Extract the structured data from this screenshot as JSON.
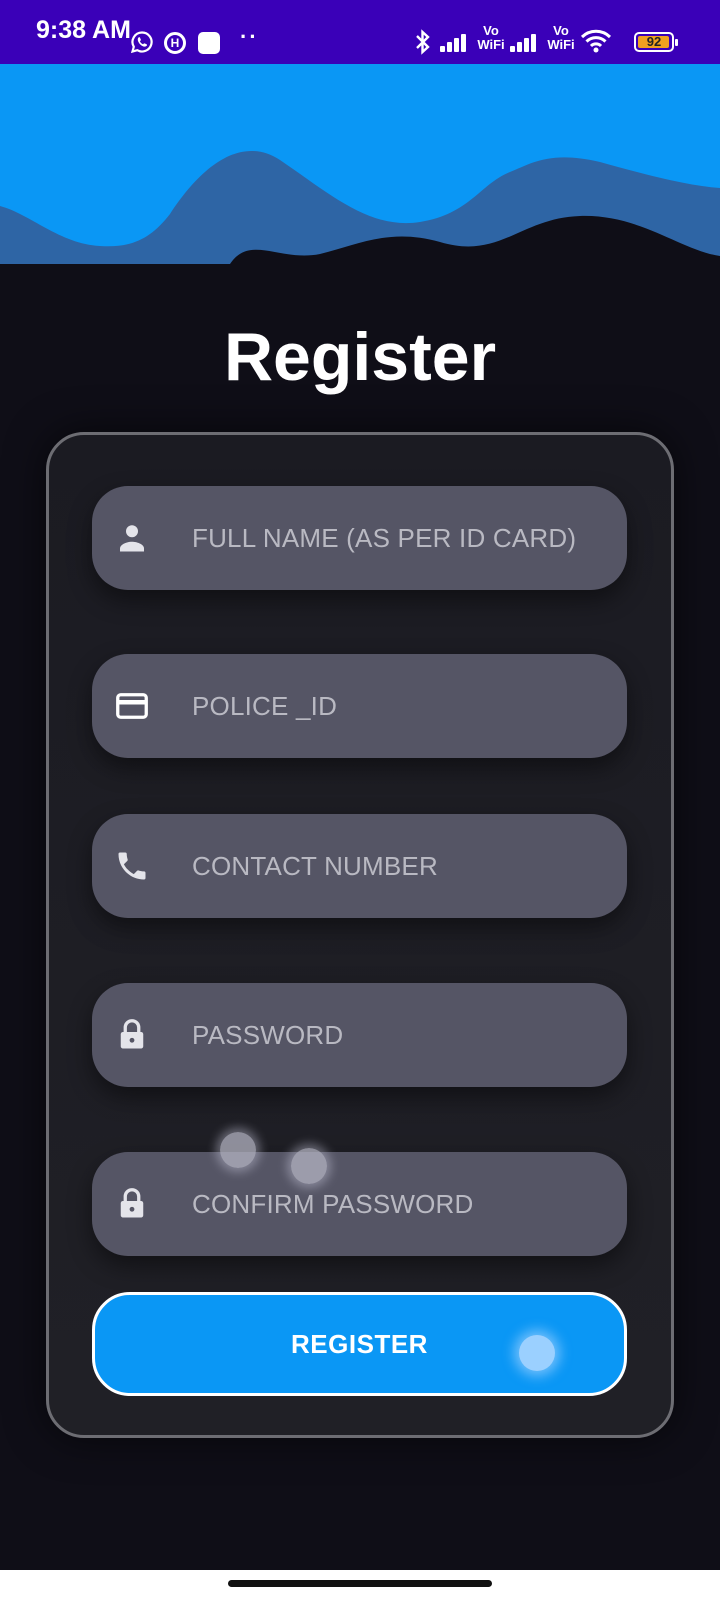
{
  "status_bar": {
    "time": "9:38 AM",
    "icons": [
      "whatsapp-icon",
      "h-icon",
      "app-square-icon",
      "bluetooth-icon",
      "signal-icon",
      "vowifi-icon",
      "wifi-icon",
      "battery-icon"
    ],
    "vowifi_1": "Vo WiFi",
    "vowifi_2": "Vo WiFi",
    "battery_percent": "92"
  },
  "page": {
    "title": "Register"
  },
  "form": {
    "fields": [
      {
        "icon": "person-icon",
        "placeholder": "FULL NAME (AS PER ID CARD)"
      },
      {
        "icon": "credit-card-icon",
        "placeholder": "POLICE _ID"
      },
      {
        "icon": "phone-icon",
        "placeholder": "CONTACT NUMBER"
      },
      {
        "icon": "lock-icon",
        "placeholder": "PASSWORD"
      },
      {
        "icon": "lock-icon",
        "placeholder": "CONFIRM PASSWORD"
      }
    ],
    "submit_label": "REGISTER"
  },
  "colors": {
    "status_bar": "#3a00b8",
    "background": "#0f0e17",
    "wave_front": "#0a97f5",
    "wave_back": "#2e65a5",
    "field": "#555565",
    "button": "#0a97f5"
  }
}
